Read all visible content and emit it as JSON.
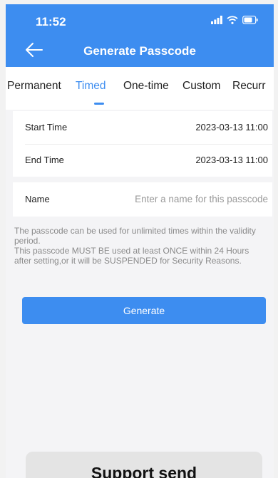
{
  "status_bar": {
    "time": "11:52",
    "icons": [
      "signal-icon",
      "wifi-icon",
      "battery-icon"
    ]
  },
  "header": {
    "title": "Generate Passcode",
    "back_icon": "back-arrow-icon"
  },
  "tabs": [
    {
      "label": "Permanent",
      "active": false
    },
    {
      "label": "Timed",
      "active": true
    },
    {
      "label": "One-time",
      "active": false
    },
    {
      "label": "Custom",
      "active": false
    },
    {
      "label": "Recurr",
      "active": false
    }
  ],
  "time_settings": {
    "start_label": "Start Time",
    "start_value": "2023-03-13 11:00",
    "end_label": "End Time",
    "end_value": "2023-03-13 11:00"
  },
  "name_field": {
    "label": "Name",
    "value": "",
    "placeholder": "Enter a name for this passcode"
  },
  "note": {
    "line1": "The passcode can be used for unlimited times within the validity period.",
    "line2": "This passcode MUST BE used at least ONCE within 24 Hours after setting,or it will be SUSPENDED for Security Reasons."
  },
  "generate_button": {
    "label": "Generate"
  },
  "banner": {
    "text": "Support send"
  },
  "colors": {
    "accent": "#3d8df0",
    "background": "#f4f4f6",
    "note_text": "#8a8a8a"
  }
}
